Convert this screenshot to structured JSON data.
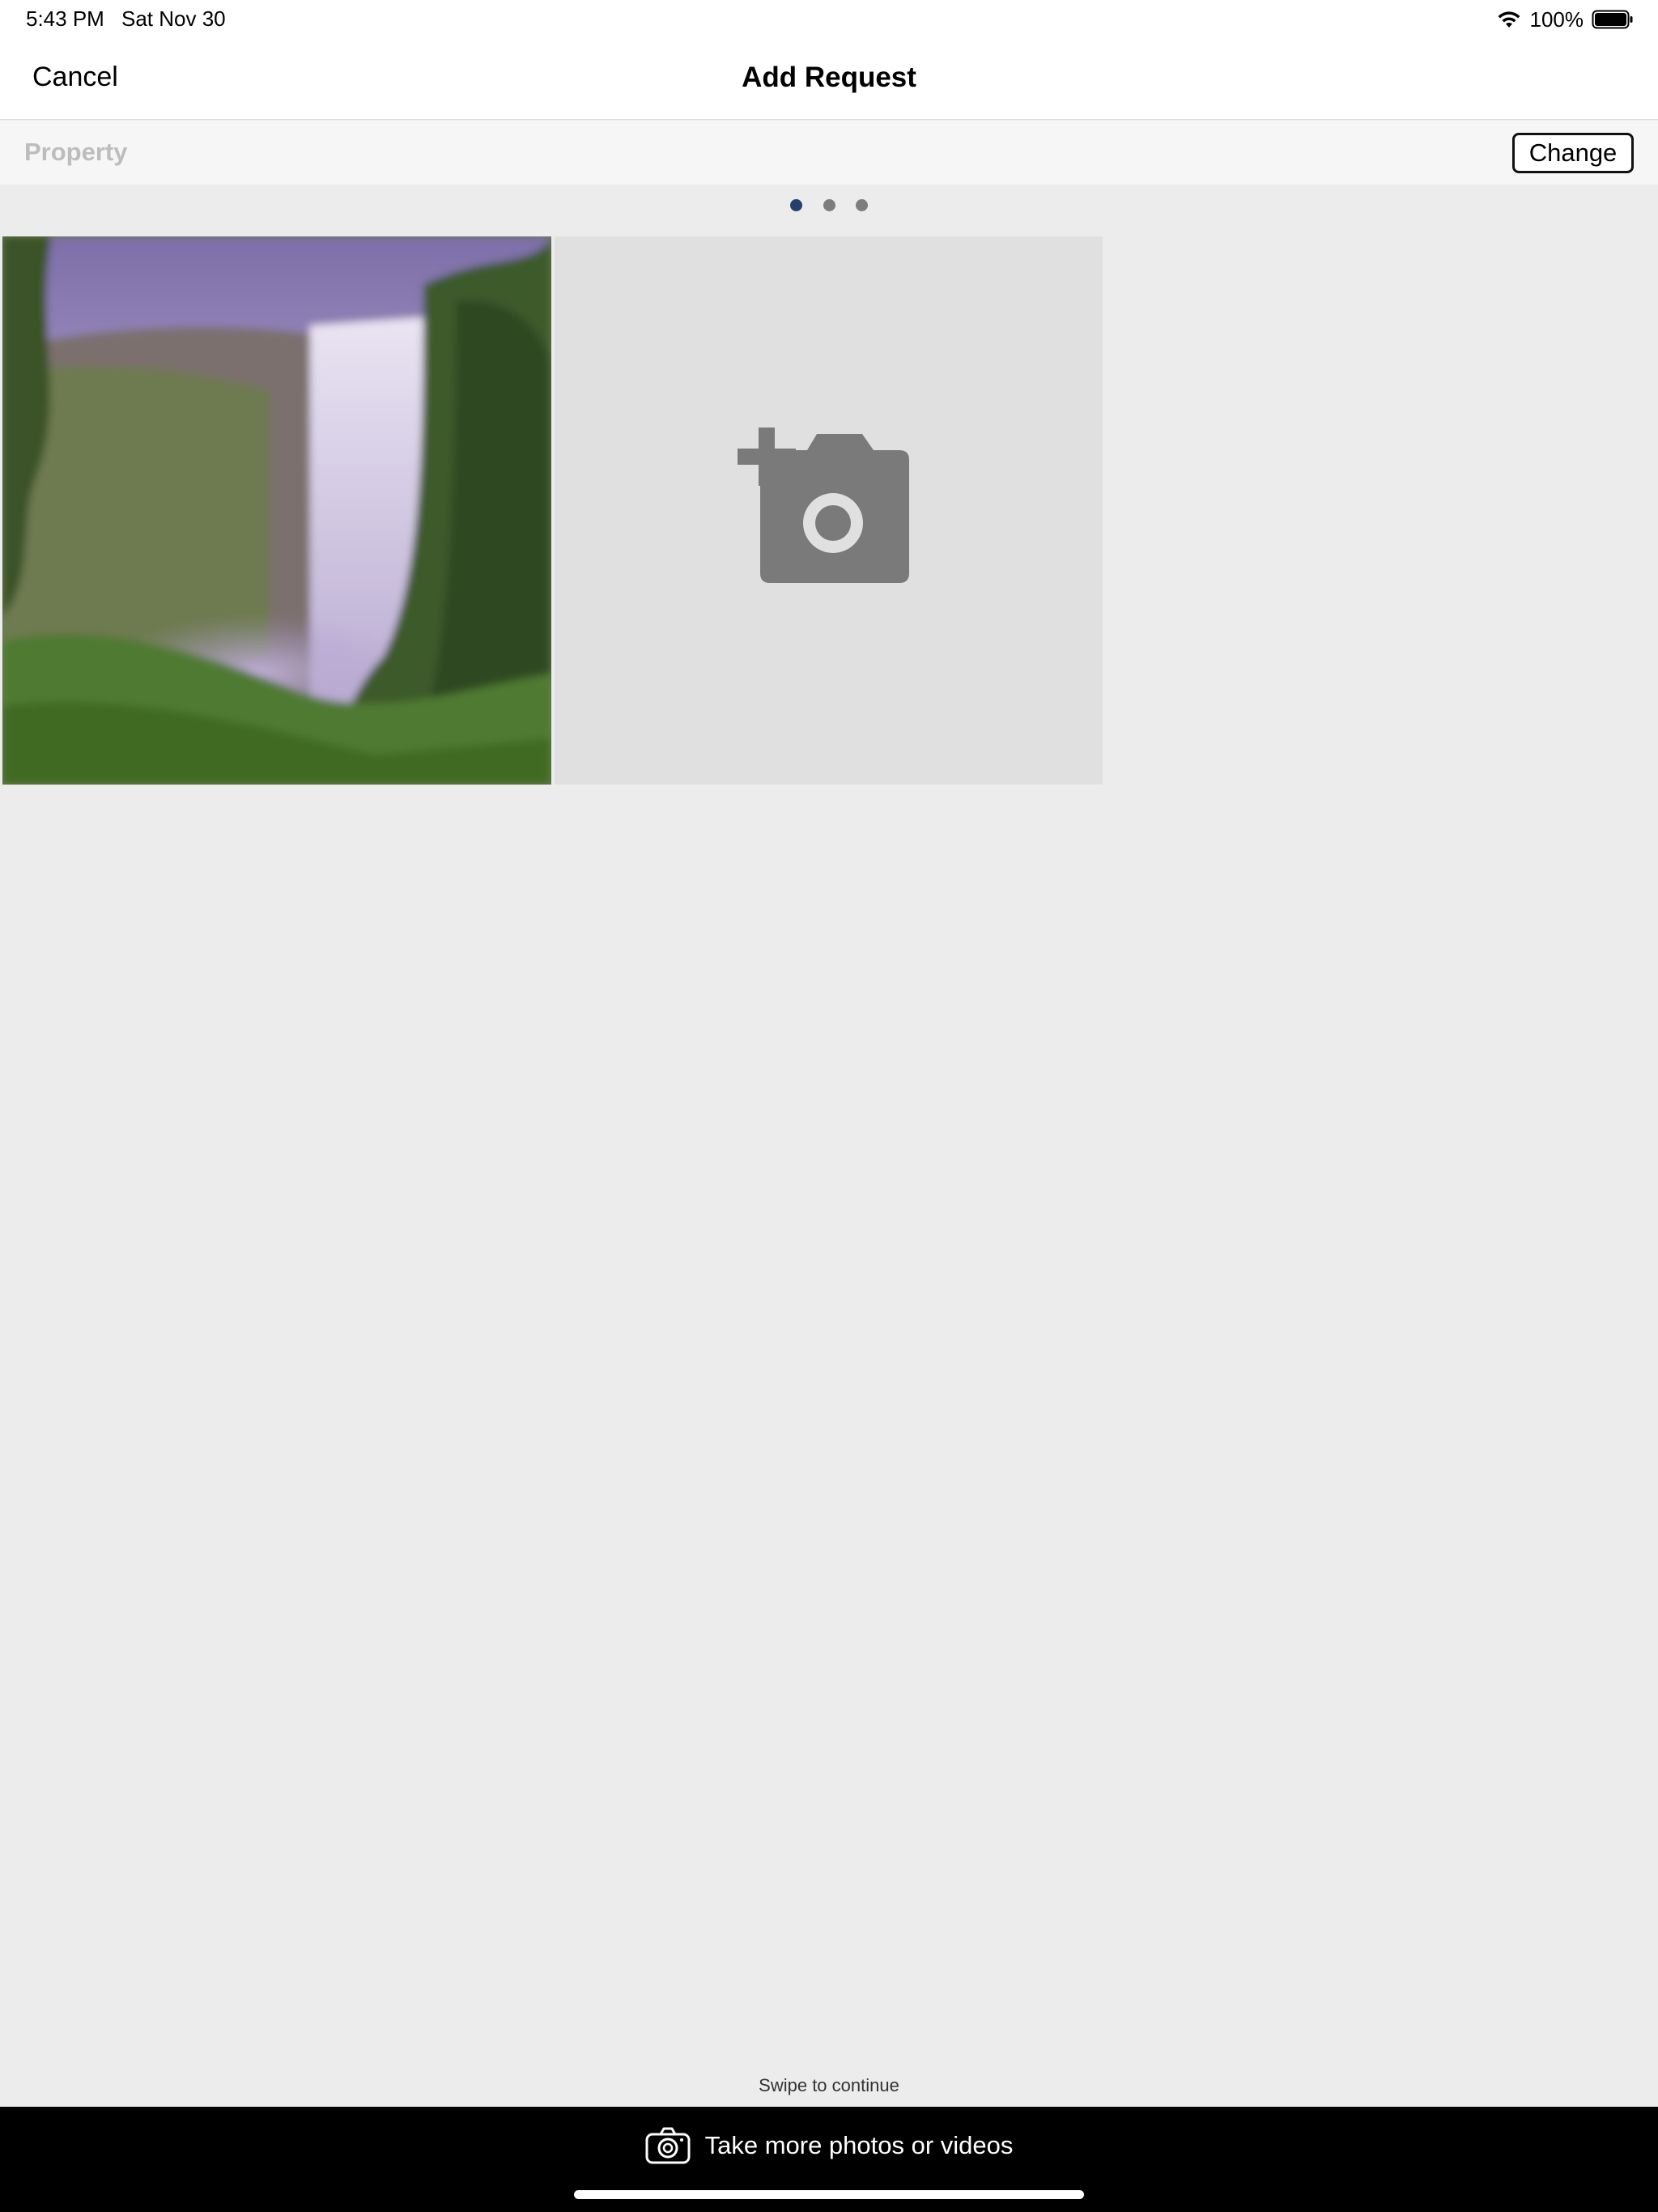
{
  "status_bar": {
    "time": "5:43 PM",
    "date": "Sat Nov 30",
    "battery_text": "100%",
    "icons": [
      "wifi-icon",
      "battery-icon"
    ]
  },
  "nav": {
    "cancel_label": "Cancel",
    "title": "Add Request"
  },
  "property": {
    "label": "Property",
    "change_label": "Change"
  },
  "pager": {
    "total": 3,
    "active_index": 0,
    "active_color": "#24406b",
    "inactive_color": "#7d7d7d"
  },
  "photos": {
    "items": [
      {
        "kind": "photo",
        "subject": "waterfall"
      },
      {
        "kind": "add",
        "icon": "add-photo-icon"
      }
    ]
  },
  "swipe_hint": "Swipe to continue",
  "bottom_bar": {
    "icon": "camera-icon",
    "label": "Take more photos or videos"
  },
  "colors": {
    "background": "#ececec",
    "bar_background": "#000000",
    "tile_placeholder": "#e0e0e0",
    "icon_gray": "#7a7a7a"
  }
}
